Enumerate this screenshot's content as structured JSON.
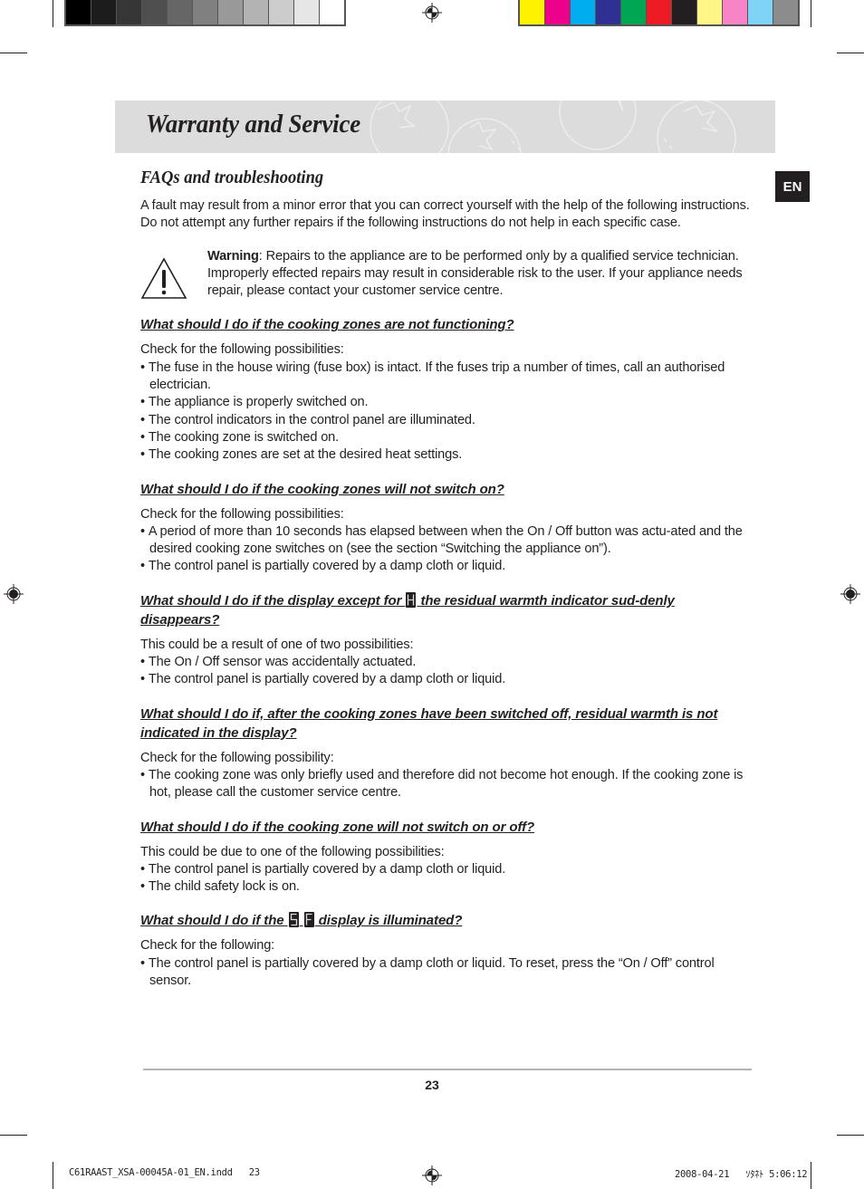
{
  "print_marks": {
    "gray_swatches": [
      "#000000",
      "#1c1c1c",
      "#363636",
      "#4f4f4f",
      "#666666",
      "#808080",
      "#999999",
      "#b3b3b3",
      "#cccccc",
      "#e6e6e6",
      "#ffffff"
    ],
    "color_swatches": [
      "#fff200",
      "#ec008c",
      "#00aeef",
      "#2e3192",
      "#00a651",
      "#ed1c24",
      "#231f20",
      "#fff685",
      "#f784c6",
      "#7fd3f7",
      "#8c8c8c"
    ]
  },
  "header": {
    "title": "Warranty and Service",
    "banner_color": "#dcdcdc"
  },
  "language_tab": "EN",
  "section": {
    "title": "FAQs and troubleshooting",
    "intro": "A fault may result from a minor error that you can correct yourself with the help of the following instructions. Do not attempt any further repairs if the following instructions do not help in each specific case.",
    "warning": {
      "label": "Warning",
      "text": ": Repairs to the appliance are to be performed only by a qualified service technician. Improperly effected repairs may result in considerable risk to the user. If your appliance needs repair, please contact your customer service centre."
    }
  },
  "faqs": [
    {
      "question": "What should I do if the cooking zones are not functioning?",
      "lead": "Check for the following possibilities:",
      "bullets": [
        "The fuse in the house wiring (fuse box) is intact. If the fuses trip a number of times, call an authorised electrician.",
        "The appliance is properly switched on.",
        "The control indicators in the control panel are illuminated.",
        "The cooking zone is switched on.",
        "The cooking zones are set at the desired heat settings."
      ]
    },
    {
      "question": "What should I do if the cooking zones will not switch on?",
      "lead": "Check for the following possibilities:",
      "bullets": [
        "A period of more than 10 seconds has elapsed between when the On / Off button was actu-ated and the desired cooking zone switches on (see the section “Switching the appliance on”).",
        "The control panel is partially covered by a damp cloth or liquid."
      ]
    },
    {
      "question_before": "What should I do if the display except for ",
      "question_symbol": "H",
      "question_after": " the residual warmth indicator sud-denly disappears?",
      "lead": "This could be a result of one of two possibilities:",
      "bullets": [
        "The On / Off sensor was accidentally actuated.",
        "The control panel is partially covered by a damp cloth or liquid."
      ]
    },
    {
      "question": "What should I do if, after the cooking zones have been switched off, residual warmth is not indicated in the display?",
      "lead": "Check for the following possibility:",
      "bullets": [
        "The cooking zone was only briefly used and therefore did not become hot enough. If the cooking zone is hot, please call the customer service centre."
      ]
    },
    {
      "question": "What should I do if the cooking zone will not switch on or off?",
      "lead": "This could be due to one of the following possibilities:",
      "bullets": [
        "The control panel is partially covered by a damp cloth or liquid.",
        "The child safety lock is on."
      ]
    },
    {
      "question_before": "What should I do if the ",
      "question_symbols": [
        "5",
        "F"
      ],
      "question_after": " display is illuminated?",
      "lead": "Check for the following:",
      "bullets": [
        "The control panel is partially covered by a damp cloth or liquid. To reset, press the “On / Off” control sensor."
      ]
    }
  ],
  "footer": {
    "page_number": "23",
    "slug_file": "C61RAAST_XSA-00045A-01_EN.indd   23",
    "slug_date": "2008-04-21   ｿﾀﾈﾄ 5:06:12"
  }
}
